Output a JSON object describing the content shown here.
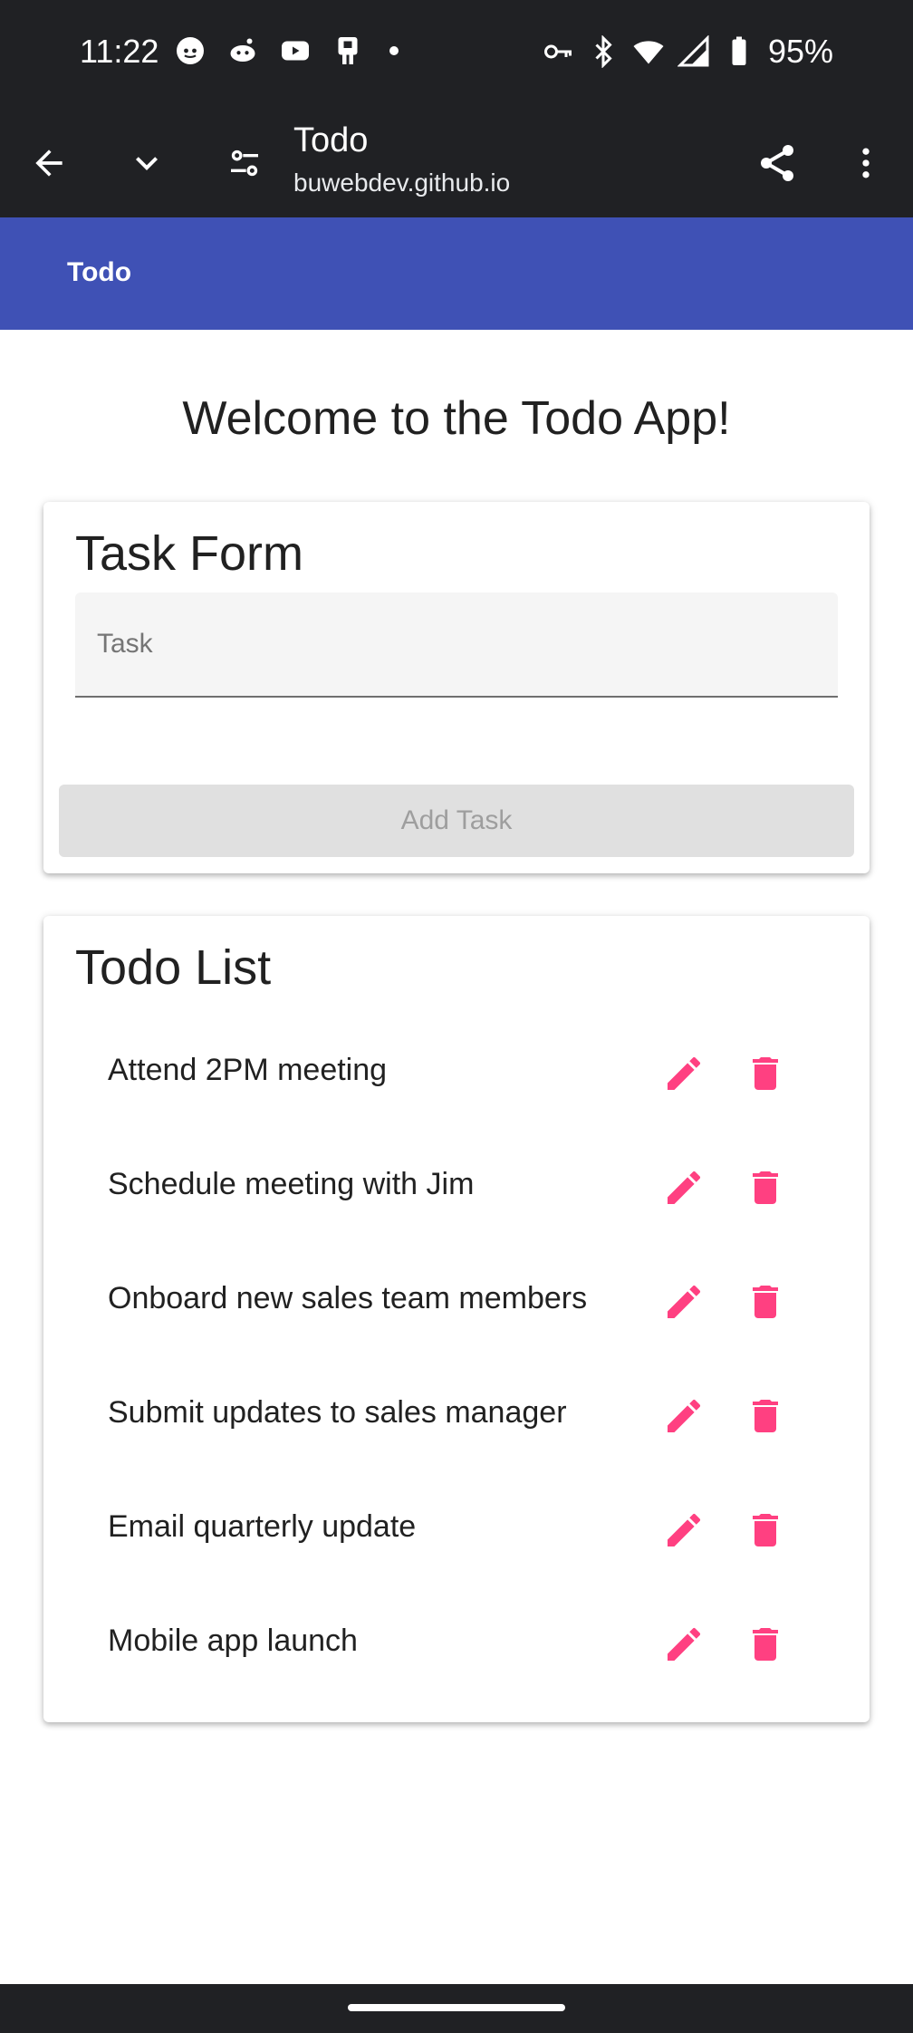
{
  "status_bar": {
    "time": "11:22",
    "battery_percent": "95%",
    "left_icons": [
      "reddit-icon",
      "reddit-alien-icon",
      "youtube-icon",
      "remote-icon",
      "notification-dot-icon"
    ],
    "right_icons": [
      "vpn-key-icon",
      "bluetooth-icon",
      "wifi-icon",
      "signal-icon",
      "battery-icon"
    ]
  },
  "browser": {
    "page_title": "Todo",
    "url": "buwebdev.github.io"
  },
  "app": {
    "title": "Todo",
    "welcome": "Welcome to the Todo App!"
  },
  "form": {
    "title": "Task Form",
    "task_placeholder": "Task",
    "task_value": "",
    "add_button_label": "Add Task",
    "add_button_disabled": true
  },
  "todo": {
    "title": "Todo List",
    "items": [
      {
        "label": "Attend 2PM meeting"
      },
      {
        "label": "Schedule meeting with Jim"
      },
      {
        "label": "Onboard new sales team members"
      },
      {
        "label": "Submit updates to sales manager"
      },
      {
        "label": "Email quarterly update"
      },
      {
        "label": "Mobile app launch"
      }
    ]
  },
  "colors": {
    "status_bg": "#202124",
    "app_bar": "#3f51b5",
    "accent_pink": "#ff4081",
    "button_disabled_bg": "#e0e0e0"
  }
}
